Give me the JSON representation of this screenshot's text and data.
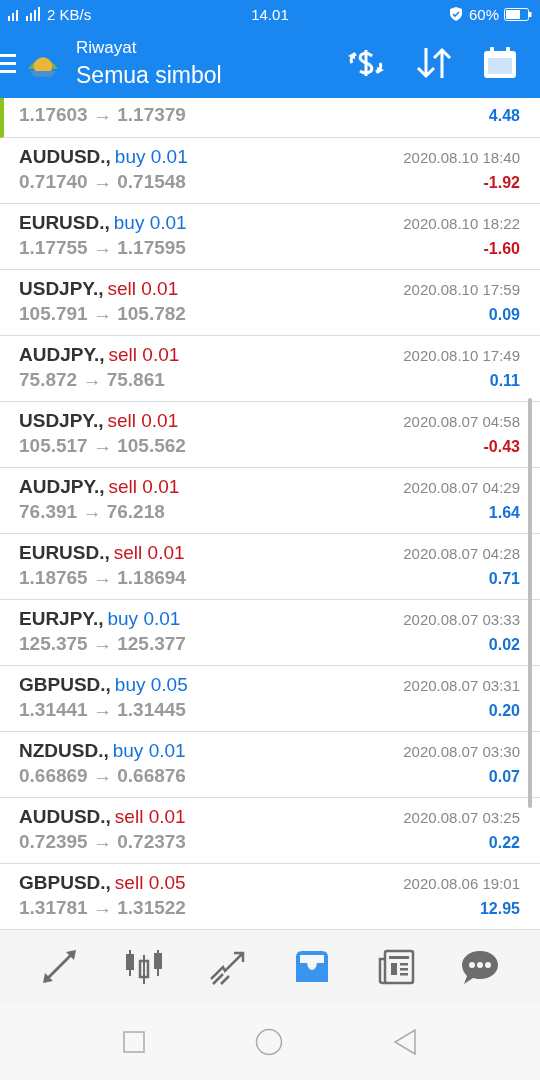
{
  "status_bar": {
    "speed": "2 KB/s",
    "time": "14.01",
    "battery": "60%"
  },
  "header": {
    "title": "Riwayat",
    "subtitle": "Semua simbol"
  },
  "partial_row": {
    "prices": "1.17603 → 1.17379",
    "profit": "4.48",
    "loss": false,
    "selected": true
  },
  "deals": [
    {
      "symbol": "AUDUSD.,",
      "action": "buy 0.01",
      "sell": false,
      "time": "2020.08.10 18:40",
      "prices": "0.71740 → 0.71548",
      "profit": "-1.92",
      "loss": true
    },
    {
      "symbol": "EURUSD.,",
      "action": "buy 0.01",
      "sell": false,
      "time": "2020.08.10 18:22",
      "prices": "1.17755 → 1.17595",
      "profit": "-1.60",
      "loss": true
    },
    {
      "symbol": "USDJPY.,",
      "action": "sell 0.01",
      "sell": true,
      "time": "2020.08.10 17:59",
      "prices": "105.791 → 105.782",
      "profit": "0.09",
      "loss": false
    },
    {
      "symbol": "AUDJPY.,",
      "action": "sell 0.01",
      "sell": true,
      "time": "2020.08.10 17:49",
      "prices": "75.872 → 75.861",
      "profit": "0.11",
      "loss": false
    },
    {
      "symbol": "USDJPY.,",
      "action": "sell 0.01",
      "sell": true,
      "time": "2020.08.07 04:58",
      "prices": "105.517 → 105.562",
      "profit": "-0.43",
      "loss": true
    },
    {
      "symbol": "AUDJPY.,",
      "action": "sell 0.01",
      "sell": true,
      "time": "2020.08.07 04:29",
      "prices": "76.391 → 76.218",
      "profit": "1.64",
      "loss": false
    },
    {
      "symbol": "EURUSD.,",
      "action": "sell 0.01",
      "sell": true,
      "time": "2020.08.07 04:28",
      "prices": "1.18765 → 1.18694",
      "profit": "0.71",
      "loss": false
    },
    {
      "symbol": "EURJPY.,",
      "action": "buy 0.01",
      "sell": false,
      "time": "2020.08.07 03:33",
      "prices": "125.375 → 125.377",
      "profit": "0.02",
      "loss": false
    },
    {
      "symbol": "GBPUSD.,",
      "action": "buy 0.05",
      "sell": false,
      "time": "2020.08.07 03:31",
      "prices": "1.31441 → 1.31445",
      "profit": "0.20",
      "loss": false
    },
    {
      "symbol": "NZDUSD.,",
      "action": "buy 0.01",
      "sell": false,
      "time": "2020.08.07 03:30",
      "prices": "0.66869 → 0.66876",
      "profit": "0.07",
      "loss": false
    },
    {
      "symbol": "AUDUSD.,",
      "action": "sell 0.01",
      "sell": true,
      "time": "2020.08.07 03:25",
      "prices": "0.72395 → 0.72373",
      "profit": "0.22",
      "loss": false
    },
    {
      "symbol": "GBPUSD.,",
      "action": "sell 0.05",
      "sell": true,
      "time": "2020.08.06 19:01",
      "prices": "1.31781 → 1.31522",
      "profit": "12.95",
      "loss": false
    }
  ],
  "bottom_nav": [
    {
      "kind": "quotes",
      "selected": false
    },
    {
      "kind": "chart",
      "selected": false
    },
    {
      "kind": "trade",
      "selected": false
    },
    {
      "kind": "history",
      "selected": true
    },
    {
      "kind": "news",
      "selected": false
    },
    {
      "kind": "chat",
      "selected": false
    }
  ]
}
